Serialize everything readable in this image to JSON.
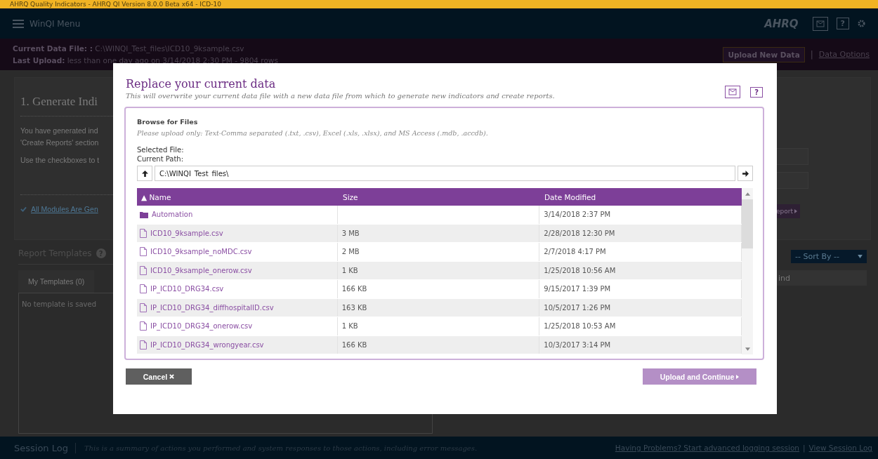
{
  "window": {
    "title": "AHRQ Quality Indicators - AHRQ QI Version 8.0.0 Beta x64 - ICD-10"
  },
  "nav": {
    "menu_label": "WinQI Menu",
    "logo": "AHRQ",
    "help": "?"
  },
  "data_bar": {
    "file_label": "Current Data File: :",
    "file_path": "C:\\WINQI_Test_files\\ICD10_9ksample.csv",
    "upload_label": "Last Upload:",
    "upload_value": "less than one day ago on 3/14/2018 2:30 PM - 9804 rows",
    "upload_button": "Upload New Data",
    "separator": "|",
    "options_link": "Data Options"
  },
  "generate": {
    "heading": "1. Generate Indi",
    "lines": [
      "You have generated ind",
      "'Create Reports' section",
      "Use the checkboxes to t"
    ],
    "status": "All Modules Are Gen",
    "report_button": "eport"
  },
  "templates": {
    "title": "Report Templates",
    "help": "?",
    "tabs": [
      {
        "label": "My Templates (0)",
        "selected": false
      }
    ],
    "empty": "No template is saved",
    "sort": "-- Sort By --",
    "find_placeholder": "ind"
  },
  "session_log": {
    "title": "Session Log",
    "description": "This is a summary of actions you performed and system responses to those actions, including error messages.",
    "problems_link": "Having Problems? Start advanced logging session",
    "separator": "|",
    "view_link": "View Session Log"
  },
  "dialog": {
    "title": "Replace your current data",
    "subtitle": "This will overwrite your current data file with a new data file from which to generate new indicators and create reports.",
    "help": "?",
    "browse_label": "Browse for Files",
    "note": "Please upload only: Text-Comma separated (.txt, .csv), Excel (.xls, .xlsx), and MS Access (.mdb, .accdb).",
    "selected_label": "Selected File:",
    "path_label": "Current Path:",
    "path": "C:\\WINQI_Test_files\\",
    "columns": [
      {
        "label": "▲ Name"
      },
      {
        "label": "Size"
      },
      {
        "label": "Date Modified"
      }
    ],
    "rows": [
      {
        "kind": "folder",
        "name": "Automation",
        "size": "",
        "date": "3/14/2018 2:37 PM"
      },
      {
        "kind": "file",
        "name": "ICD10_9ksample.csv",
        "size": "3 MB",
        "date": "2/28/2018 12:30 PM"
      },
      {
        "kind": "file",
        "name": "ICD10_9ksample_noMDC.csv",
        "size": "2 MB",
        "date": "2/7/2018 4:17 PM"
      },
      {
        "kind": "file",
        "name": "ICD10_9ksample_onerow.csv",
        "size": "1 KB",
        "date": "1/25/2018 10:56 AM"
      },
      {
        "kind": "file",
        "name": "IP_ICD10_DRG34.csv",
        "size": "166 KB",
        "date": "9/15/2017 1:39 PM"
      },
      {
        "kind": "file",
        "name": "IP_ICD10_DRG34_diffhospitalID.csv",
        "size": "163 KB",
        "date": "10/5/2017 1:26 PM"
      },
      {
        "kind": "file",
        "name": "IP_ICD10_DRG34_onerow.csv",
        "size": "1 KB",
        "date": "1/25/2018 10:53 AM"
      },
      {
        "kind": "file",
        "name": "IP_ICD10_DRG34_wrongyear.csv",
        "size": "166 KB",
        "date": "10/3/2017 3:14 PM"
      }
    ],
    "cancel_button": "Cancel",
    "upload_button": "Upload and Continue"
  }
}
